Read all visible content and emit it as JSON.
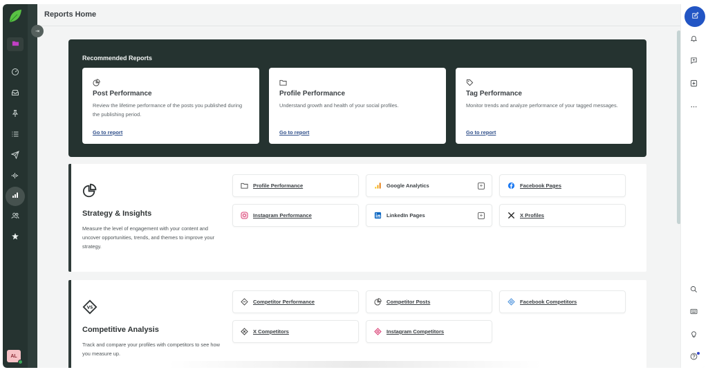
{
  "header": {
    "title": "Reports Home"
  },
  "left_nav": {
    "items": [
      {
        "name": "folder",
        "active": false
      },
      {
        "name": "dashboard",
        "active": false
      },
      {
        "name": "inbox",
        "active": false
      },
      {
        "name": "pin",
        "active": false
      },
      {
        "name": "list",
        "active": false
      },
      {
        "name": "publish",
        "active": false
      },
      {
        "name": "listening",
        "active": false
      },
      {
        "name": "reports",
        "active": true
      },
      {
        "name": "people",
        "active": false
      },
      {
        "name": "reviews",
        "active": false
      }
    ],
    "avatar_initials": "AL",
    "collapse_label": "⇥"
  },
  "recommended": {
    "title": "Recommended Reports",
    "cards": [
      {
        "icon": "pie-chart-icon",
        "title": "Post Performance",
        "description": "Review the lifetime performance of the posts you published during the publishing period.",
        "link": "Go to report"
      },
      {
        "icon": "folder-icon",
        "title": "Profile Performance",
        "description": "Understand growth and health of your social profiles.",
        "link": "Go to report"
      },
      {
        "icon": "tag-icon",
        "title": "Tag Performance",
        "description": "Monitor trends and analyze performance of your tagged messages.",
        "link": "Go to report"
      }
    ]
  },
  "sections": [
    {
      "title": "Strategy & Insights",
      "description": "Measure the level of engagement with your content and uncover opportunities, trends, and themes to improve your strategy.",
      "links": [
        {
          "label": "Profile Performance",
          "icon": "folder-icon",
          "add": false
        },
        {
          "label": "Google Analytics",
          "icon": "google-analytics-icon",
          "add": true
        },
        {
          "label": "Facebook Pages",
          "icon": "facebook-icon",
          "add": false
        },
        {
          "label": "Instagram Performance",
          "icon": "instagram-icon",
          "add": false
        },
        {
          "label": "LinkedIn Pages",
          "icon": "linkedin-icon",
          "add": true
        },
        {
          "label": "X Profiles",
          "icon": "x-icon",
          "add": false
        }
      ]
    },
    {
      "title": "Competitive Analysis",
      "description": "Track and compare your profiles with competitors to see how you measure up.",
      "links": [
        {
          "label": "Competitor Performance",
          "icon": "competitor-icon",
          "add": false
        },
        {
          "label": "Competitor Posts",
          "icon": "pie-chart-icon",
          "add": false
        },
        {
          "label": "Facebook Competitors",
          "icon": "facebook-competitor-icon",
          "add": false
        },
        {
          "label": "X Competitors",
          "icon": "x-competitor-icon",
          "add": false
        },
        {
          "label": "Instagram Competitors",
          "icon": "instagram-competitor-icon",
          "add": false
        }
      ]
    }
  ],
  "colors": {
    "nav_bg": "#253330",
    "accent_blue": "#2255c4",
    "link_blue": "#2f4f8a",
    "instagram": "#d6336c",
    "facebook": "#1877f2",
    "linkedin": "#0a66c2",
    "google_analytics": "#f4a300"
  },
  "add_symbol": "+"
}
